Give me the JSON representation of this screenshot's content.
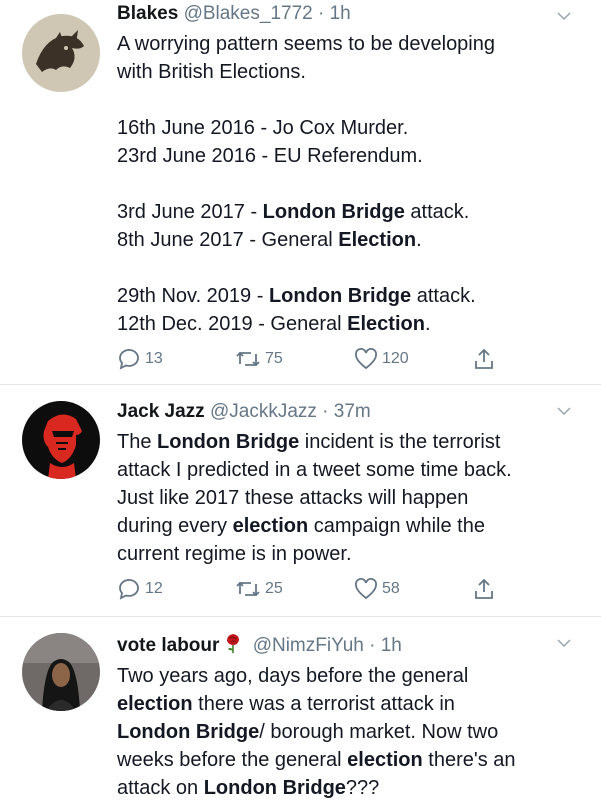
{
  "tweets": [
    {
      "name": "Blakes",
      "handle": "@Blakes_1772",
      "time": "· 1h",
      "lines": [
        {
          "parts": [
            "A worrying pattern seems to be developing"
          ]
        },
        {
          "parts": [
            "with British Elections."
          ]
        },
        {
          "gap": true
        },
        {
          "parts": [
            "16th June 2016 - Jo Cox Murder."
          ]
        },
        {
          "parts": [
            "23rd June 2016 - EU Referendum."
          ]
        },
        {
          "gap": true
        },
        {
          "parts": [
            "3rd June 2017 - ",
            {
              "b": "London Bridge"
            },
            " attack."
          ]
        },
        {
          "parts": [
            "8th June 2017 - General ",
            {
              "b": "Election"
            },
            "."
          ]
        },
        {
          "gap": true
        },
        {
          "parts": [
            "29th Nov. 2019 - ",
            {
              "b": "London Bridge"
            },
            " attack."
          ]
        },
        {
          "parts": [
            "12th Dec. 2019 - General ",
            {
              "b": "Election"
            },
            "."
          ]
        }
      ],
      "replies": "13",
      "retweets": "75",
      "likes": "120"
    },
    {
      "name": "Jack Jazz",
      "handle": "@JackkJazz",
      "time": "· 37m",
      "lines": [
        {
          "parts": [
            "The ",
            {
              "b": "London Bridge"
            },
            " incident is the terrorist"
          ]
        },
        {
          "parts": [
            "attack I predicted in a tweet some time back."
          ]
        },
        {
          "parts": [
            "Just like 2017 these attacks will happen"
          ]
        },
        {
          "parts": [
            "during every ",
            {
              "b": "election"
            },
            " campaign while the"
          ]
        },
        {
          "parts": [
            "current regime is in power."
          ]
        }
      ],
      "replies": "12",
      "retweets": "25",
      "likes": "58"
    },
    {
      "name": "vote labour",
      "handle": "@NimzFiYuh",
      "time": "· 1h",
      "lines": [
        {
          "parts": [
            "Two years ago, days before the general"
          ]
        },
        {
          "parts": [
            {
              "b": "election"
            },
            " there was a terrorist attack in"
          ]
        },
        {
          "parts": [
            {
              "b": "London Bridge"
            },
            "/ borough market. Now two"
          ]
        },
        {
          "parts": [
            "weeks before the general ",
            {
              "b": "election"
            },
            " there's an"
          ]
        },
        {
          "parts": [
            "attack on ",
            {
              "b": "London Bridge"
            },
            "???"
          ]
        }
      ]
    }
  ],
  "colors": {
    "text": "#14171a",
    "muted": "#657786",
    "divider": "#e3e6ea",
    "rose": "#c0161b"
  }
}
